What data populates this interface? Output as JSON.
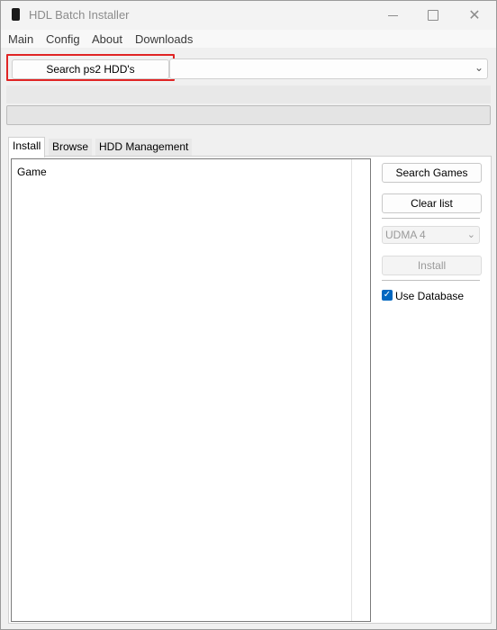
{
  "window": {
    "title": "HDL Batch Installer",
    "icons": {
      "app": "app-icon",
      "minimize": "minimize-icon",
      "maximize": "maximize-icon",
      "close": "close-icon"
    }
  },
  "menu": {
    "items": [
      "Main",
      "Config",
      "About",
      "Downloads"
    ]
  },
  "toolbar": {
    "search_hdd_label": "Search ps2 HDD's",
    "hdd_select_value": "",
    "highlight_color": "#e02424"
  },
  "tabs": [
    "Install",
    "Browse",
    "HDD Management"
  ],
  "game_list": {
    "column_header": "Game"
  },
  "side": {
    "search_games_label": "Search Games",
    "clear_list_label": "Clear list",
    "udma_value": "UDMA 4",
    "install_label": "Install",
    "use_database_label": "Use Database",
    "use_database_checked": true,
    "accent_color": "#0067c0"
  }
}
